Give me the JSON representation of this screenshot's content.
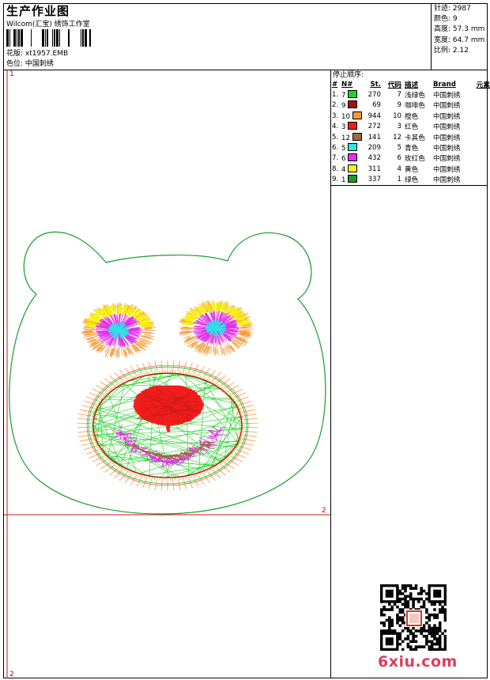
{
  "header": {
    "title": "生产作业图",
    "company": "Wilcom(汇宝) 绣饰工作室",
    "design_label": "花版:",
    "design_value": "xt1957.EMB",
    "colorway_label": "色位:",
    "colorway_value": "中国刺绣"
  },
  "stats": [
    {
      "label": "针迹:",
      "value": "2987"
    },
    {
      "label": "颜色:",
      "value": "9"
    },
    {
      "label": "高度:",
      "value": "57.3 mm"
    },
    {
      "label": "宽度:",
      "value": "64.7 mm"
    },
    {
      "label": "比例:",
      "value": "2.12"
    }
  ],
  "stop_sequence": {
    "title": "停止顺序:",
    "headers": [
      "#",
      "N#",
      "St.",
      "代码",
      "描述",
      "Brand",
      "元素"
    ],
    "rows": [
      {
        "idx": "1.",
        "n": "7",
        "color": "#22d126",
        "st": "270",
        "code": "7",
        "desc": "浅绿色",
        "brand": "中国刺绣"
      },
      {
        "idx": "2.",
        "n": "9",
        "color": "#a80f0f",
        "st": "69",
        "code": "9",
        "desc": "咖啡色",
        "brand": "中国刺绣"
      },
      {
        "idx": "3.",
        "n": "10",
        "color": "#f59a3b",
        "st": "944",
        "code": "10",
        "desc": "橙色",
        "brand": "中国刺绣"
      },
      {
        "idx": "4.",
        "n": "3",
        "color": "#f21c1c",
        "st": "272",
        "code": "3",
        "desc": "红色",
        "brand": "中国刺绣"
      },
      {
        "idx": "5.",
        "n": "12",
        "color": "#9a6a3d",
        "st": "141",
        "code": "12",
        "desc": "卡其色",
        "brand": "中国刺绣"
      },
      {
        "idx": "6.",
        "n": "5",
        "color": "#2de2e8",
        "st": "209",
        "code": "5",
        "desc": "青色",
        "brand": "中国刺绣"
      },
      {
        "idx": "7.",
        "n": "6",
        "color": "#e22fe8",
        "st": "432",
        "code": "6",
        "desc": "玫红色",
        "brand": "中国刺绣"
      },
      {
        "idx": "8.",
        "n": "4",
        "color": "#f5f20e",
        "st": "311",
        "code": "4",
        "desc": "黄色",
        "brand": "中国刺绣"
      },
      {
        "idx": "9.",
        "n": "1",
        "color": "#1a9a2a",
        "st": "337",
        "code": "1",
        "desc": "绿色",
        "brand": "中国刺绣"
      }
    ]
  },
  "axis": {
    "tl": "1",
    "right": "2",
    "bottom": "2"
  },
  "watermark": "6xiu.com",
  "colors": {
    "outline": "#1a9a2a",
    "axis": "#d01515"
  }
}
